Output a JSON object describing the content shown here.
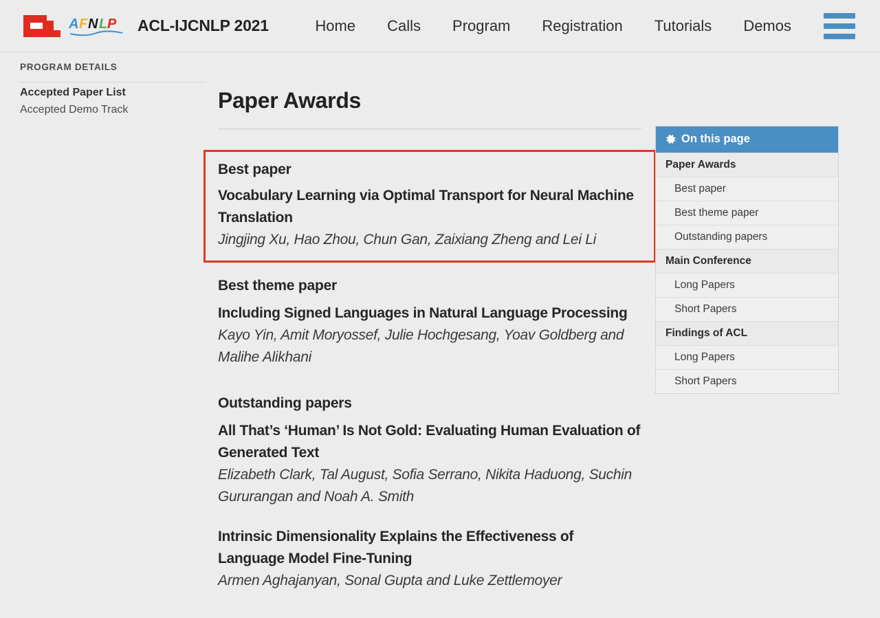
{
  "header": {
    "logo_acl": "acl-logo-icon",
    "logo_afnlp": "afnlp-logo-icon",
    "brand_title": "ACL-IJCNLP 2021",
    "nav": [
      {
        "label": "Home",
        "name": "nav-link-home"
      },
      {
        "label": "Calls",
        "name": "nav-link-calls"
      },
      {
        "label": "Program",
        "name": "nav-link-program"
      },
      {
        "label": "Registration",
        "name": "nav-link-registration"
      },
      {
        "label": "Tutorials",
        "name": "nav-link-tutorials"
      },
      {
        "label": "Demos",
        "name": "nav-link-demos"
      }
    ],
    "menu_icon": "hamburger-menu-icon",
    "accent_blue": "#4a8fc3"
  },
  "left_sidebar": {
    "title": "PROGRAM DETAILS",
    "items": [
      {
        "label": "Accepted Paper List",
        "active": true
      },
      {
        "label": "Accepted Demo Track",
        "active": false
      }
    ]
  },
  "main": {
    "page_title": "Paper Awards",
    "highlight_color": "#dc3a22",
    "sections": [
      {
        "label": "Best paper",
        "highlighted": true,
        "papers": [
          {
            "title": "Vocabulary Learning via Optimal Transport for Neural Machine Translation",
            "authors": "Jingjing Xu, Hao Zhou, Chun Gan, Zaixiang Zheng and Lei Li"
          }
        ]
      },
      {
        "label": "Best theme paper",
        "highlighted": false,
        "papers": [
          {
            "title": "Including Signed Languages in Natural Language Processing",
            "authors": "Kayo Yin, Amit Moryossef, Julie Hochgesang, Yoav Goldberg and Malihe Alikhani"
          }
        ]
      },
      {
        "label": "Outstanding papers",
        "highlighted": false,
        "papers": [
          {
            "title": "All That’s ‘Human’ Is Not Gold: Evaluating Human Evaluation of Generated Text",
            "authors": "Elizabeth Clark, Tal August, Sofia Serrano, Nikita Haduong, Suchin Gururangan and Noah A. Smith"
          },
          {
            "title": "Intrinsic Dimensionality Explains the Effectiveness of Language Model Fine-Tuning",
            "authors": "Armen Aghajanyan, Sonal Gupta and Luke Zettlemoyer"
          }
        ]
      }
    ]
  },
  "toc": {
    "icon": "gear-icon",
    "header": "On this page",
    "header_bg": "#4a8fc3",
    "rows": [
      {
        "label": "Paper Awards",
        "type": "group"
      },
      {
        "label": "Best paper",
        "type": "child"
      },
      {
        "label": "Best theme paper",
        "type": "child"
      },
      {
        "label": "Outstanding papers",
        "type": "child"
      },
      {
        "label": "Main Conference",
        "type": "group"
      },
      {
        "label": "Long Papers",
        "type": "child"
      },
      {
        "label": "Short Papers",
        "type": "child"
      },
      {
        "label": "Findings of ACL",
        "type": "group"
      },
      {
        "label": "Long Papers",
        "type": "child"
      },
      {
        "label": "Short Papers",
        "type": "child"
      }
    ]
  }
}
